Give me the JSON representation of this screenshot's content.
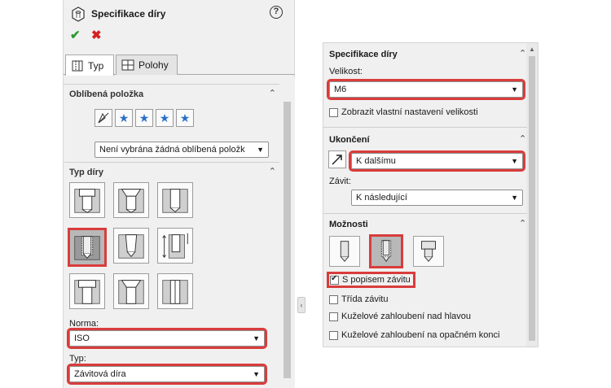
{
  "left": {
    "title": "Specifikace díry",
    "help_symbol": "?",
    "ok_symbol": "✔",
    "cancel_symbol": "✖",
    "tabs": [
      {
        "label": "Typ",
        "active": true
      },
      {
        "label": "Polohy",
        "active": false
      }
    ],
    "favorites": {
      "title": "Oblíbená položka",
      "selected": "Není vybrána žádná oblíbená položk",
      "icons": [
        "favorite-none-icon",
        "add-favorite-icon",
        "remove-favorite-icon",
        "save-favorite-icon",
        "load-favorite-icon"
      ]
    },
    "hole_type": {
      "title": "Typ díry",
      "buttons": [
        "counterbore-icon",
        "countersink-icon",
        "hole-icon",
        "straight-tap-icon",
        "tapered-tap-icon",
        "legacy-hole-icon",
        "counterbore-slot-icon",
        "countersink-slot-icon",
        "slot-icon"
      ],
      "selected_index": 3,
      "standard_label": "Norma:",
      "standard_value": "ISO",
      "type_label": "Typ:",
      "type_value": "Závitová díra"
    }
  },
  "right": {
    "spec": {
      "title": "Specifikace díry",
      "size_label": "Velikost:",
      "size_value": "M6",
      "custom_size_label": "Zobrazit vlastní nastavení velikosti",
      "custom_size_checked": false
    },
    "end": {
      "title": "Ukončení",
      "end_value": "K dalšímu",
      "thread_label": "Závit:",
      "thread_value": "K následující"
    },
    "options": {
      "title": "Možnosti",
      "buttons": [
        "no-thread-icon",
        "cosmetic-thread-icon",
        "remove-thread-icon"
      ],
      "selected_index": 1,
      "checkboxes": [
        {
          "label": "S popisem závitu",
          "checked": true
        },
        {
          "label": "Třída závitu",
          "checked": false
        },
        {
          "label": "Kuželové zahloubení nad hlavou",
          "checked": false
        },
        {
          "label": "Kuželové zahloubení na opačném konci",
          "checked": false
        }
      ]
    }
  },
  "colors": {
    "highlight": "#d93c3c",
    "panel_bg": "#f0f0f0",
    "ok": "#2f9a2f",
    "cancel": "#d42121"
  }
}
